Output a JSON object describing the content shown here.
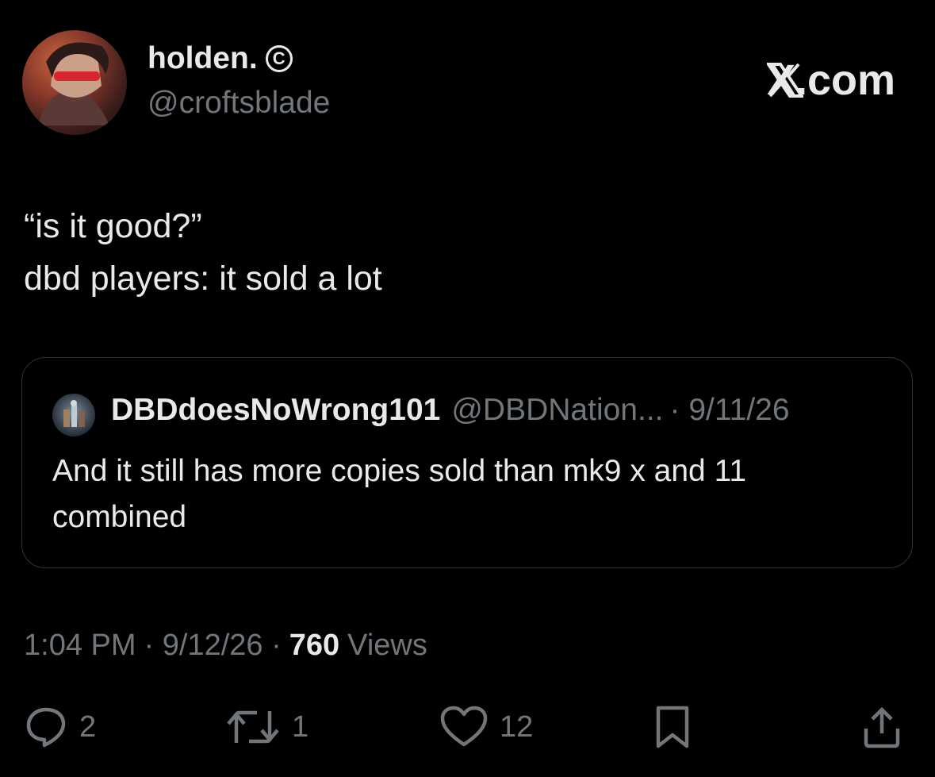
{
  "author": {
    "display_name": "holden.",
    "handle": "@croftsblade",
    "avatar_icon": "avatar-image"
  },
  "brand": {
    "label": "X.com",
    "icon": "x-logo-icon"
  },
  "tweet": {
    "text": "“is it good?”\ndbd players: it sold a lot"
  },
  "quote": {
    "display_name": "DBDdoesNoWrong101",
    "handle": "@DBDNation...",
    "date": "· 9/11/26",
    "text": "And it still has more copies sold than mk9 x and 11 combined"
  },
  "meta": {
    "time": "1:04 PM",
    "date": "· 9/12/26 ·",
    "views_count": "760",
    "views_label": "Views"
  },
  "actions": {
    "reply_count": "2",
    "retweet_count": "1",
    "like_count": "12"
  },
  "colors": {
    "background": "#000000",
    "primary_text": "#e7e9ea",
    "secondary_text": "#71767b",
    "border": "#2f3336"
  }
}
